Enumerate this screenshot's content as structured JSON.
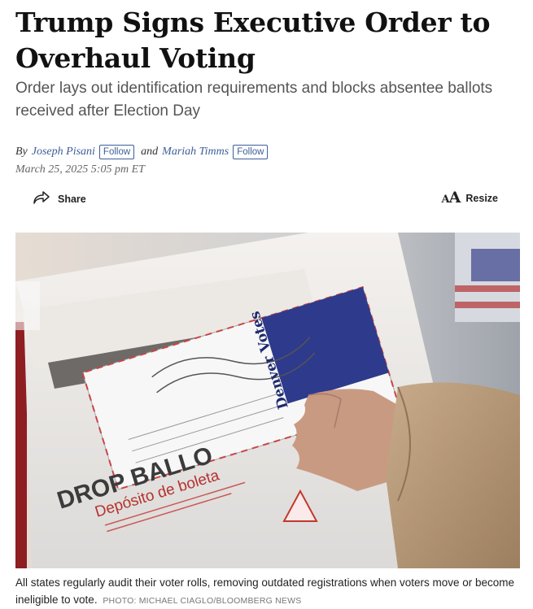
{
  "article": {
    "headline": "Trump Signs Executive Order to Overhaul Voting",
    "dek": "Order lays out identification requirements and blocks absentee ballots received after Election Day",
    "byline": {
      "by": "By",
      "and": "and",
      "authors": [
        {
          "name": "Joseph Pisani",
          "follow_label": "Follow"
        },
        {
          "name": "Mariah Timms",
          "follow_label": "Follow"
        }
      ]
    },
    "dateline": "March 25, 2025 5:05 pm ET"
  },
  "tools": {
    "share_label": "Share",
    "share_icon": "share-arrow-icon",
    "resize_label": "Resize",
    "resize_icon": "text-resize-icon"
  },
  "photo": {
    "box_text_main": "DROP BALLO",
    "box_text_spanish": "Depósito de boleta",
    "envelope_brand": "Denver Votes"
  },
  "caption": {
    "text": "All states regularly audit their voter rolls, removing outdated registrations when voters move or become ineligible to vote.",
    "credit": "PHOTO: MICHAEL CIAGLO/BLOOMBERG NEWS"
  },
  "colors": {
    "author_link": "#3d5e99",
    "dek_gray": "#555555",
    "envelope_blue": "#2e3a8c",
    "sweater_tan": "#b89a78"
  }
}
